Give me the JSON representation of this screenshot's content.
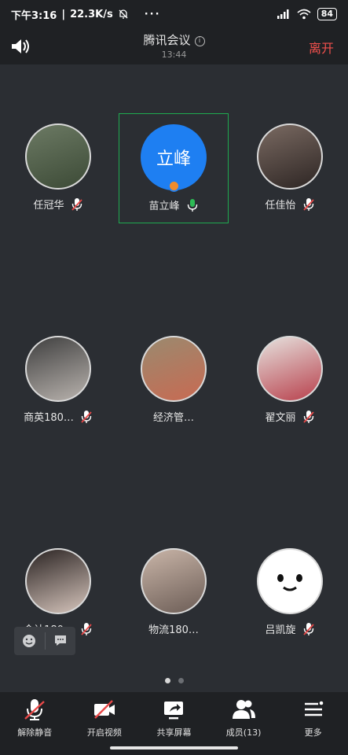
{
  "status_bar": {
    "time": "下午3:16",
    "net_speed": "22.3K/s",
    "more": "···",
    "battery": "84"
  },
  "header": {
    "title": "腾讯会议",
    "timer": "13:44",
    "leave_label": "离开"
  },
  "participants": [
    {
      "name": "任冠华",
      "muted": true,
      "avatar_type": "photo"
    },
    {
      "name": "苗立峰",
      "muted": false,
      "avatar_type": "text",
      "avatar_text": "立峰",
      "active_speaker": true,
      "host": true
    },
    {
      "name": "任佳怡",
      "muted": true,
      "avatar_type": "photo"
    },
    {
      "name": "商英180…",
      "muted": true,
      "avatar_type": "photo"
    },
    {
      "name": "经济管…",
      "muted": false,
      "avatar_type": "photo"
    },
    {
      "name": "翟文丽",
      "muted": true,
      "avatar_type": "photo"
    },
    {
      "name": "会计180…",
      "muted": true,
      "avatar_type": "photo"
    },
    {
      "name": "物流180…",
      "muted": false,
      "avatar_type": "photo"
    },
    {
      "name": "吕凯旋",
      "muted": true,
      "avatar_type": "photo"
    }
  ],
  "pager": {
    "pages": 2,
    "current": 1
  },
  "toolbar": {
    "unmute": "解除静音",
    "video": "开启视频",
    "share": "共享屏幕",
    "members": "成员(13)",
    "more": "更多"
  },
  "colors": {
    "background": "#2b2e33",
    "bar": "#1f2124",
    "leave": "#f0504c",
    "active_border": "#1faa50",
    "avatar_blue": "#1e7ff2",
    "mic_on": "#2dbb55",
    "mic_muted": "#e84848"
  }
}
